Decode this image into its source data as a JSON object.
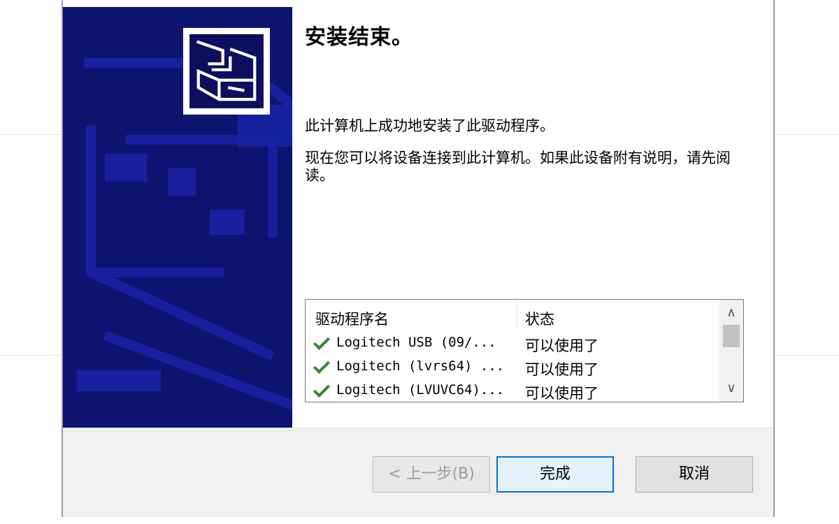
{
  "dialog": {
    "title": "安装结束。",
    "message1": "此计算机上成功地安装了此驱动程序。",
    "message2": "现在您可以将设备连接到此计算机。如果此设备附有说明，请先阅读。",
    "side_logo_icon": "hardware-install-icon"
  },
  "driver_list": {
    "headers": {
      "name": "驱动程序名",
      "status": "状态"
    },
    "rows": [
      {
        "name": "Logitech USB  (09/...",
        "status": "可以使用了"
      },
      {
        "name": "Logitech (lvrs64) ...",
        "status": "可以使用了"
      },
      {
        "name": "Logitech (LVUVC64)...",
        "status": "可以使用了"
      }
    ],
    "scroll_up_icon": "chevron-up-icon",
    "scroll_down_icon": "chevron-down-icon"
  },
  "buttons": {
    "back": "< 上一步(B)",
    "finish": "完成",
    "cancel": "取消"
  },
  "colors": {
    "side_panel": "#0d1470",
    "check": "#2f8a34",
    "focus": "#0078d7"
  }
}
